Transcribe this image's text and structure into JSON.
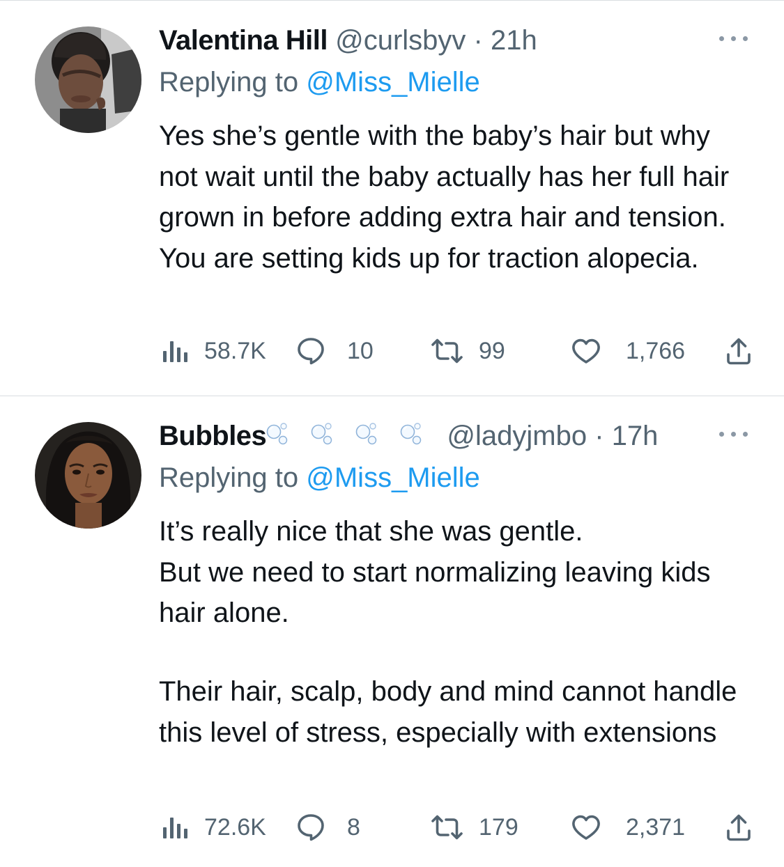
{
  "tweets": [
    {
      "name": "Valentina Hill",
      "handle": "@curlsbyv",
      "separator": "·",
      "time": "21h",
      "replying_prefix": "Replying to",
      "replying_to": "@Miss_Mielle",
      "text": "Yes she’s gentle with the baby’s hair but why not wait until the baby actually has her full hair grown in before adding extra hair and tension. You are setting kids up for traction alopecia.",
      "views": "58.7K",
      "replies": "10",
      "retweets": "99",
      "likes": "1,766"
    },
    {
      "name": "Bubbles",
      "name_decoration": "bubble emoji ×4",
      "handle": "@ladyjmbo",
      "separator": "·",
      "time": "17h",
      "replying_prefix": "Replying to",
      "replying_to": "@Miss_Mielle",
      "text_1": "It’s really nice that she was gentle.\nBut we need to start normalizing leaving kids hair alone.",
      "text_2": "Their hair, scalp, body and mind cannot handle this level of stress, especially with extensions",
      "views": "72.6K",
      "replies": "8",
      "retweets": "179",
      "likes": "2,371"
    }
  ],
  "icons": [
    "more-icon",
    "views-icon",
    "reply-icon",
    "retweet-icon",
    "like-icon",
    "share-icon"
  ],
  "colors": {
    "link": "#1d9bf0",
    "secondary_text": "#536471",
    "primary_text": "#0f1419",
    "divider": "#d9dde0"
  }
}
